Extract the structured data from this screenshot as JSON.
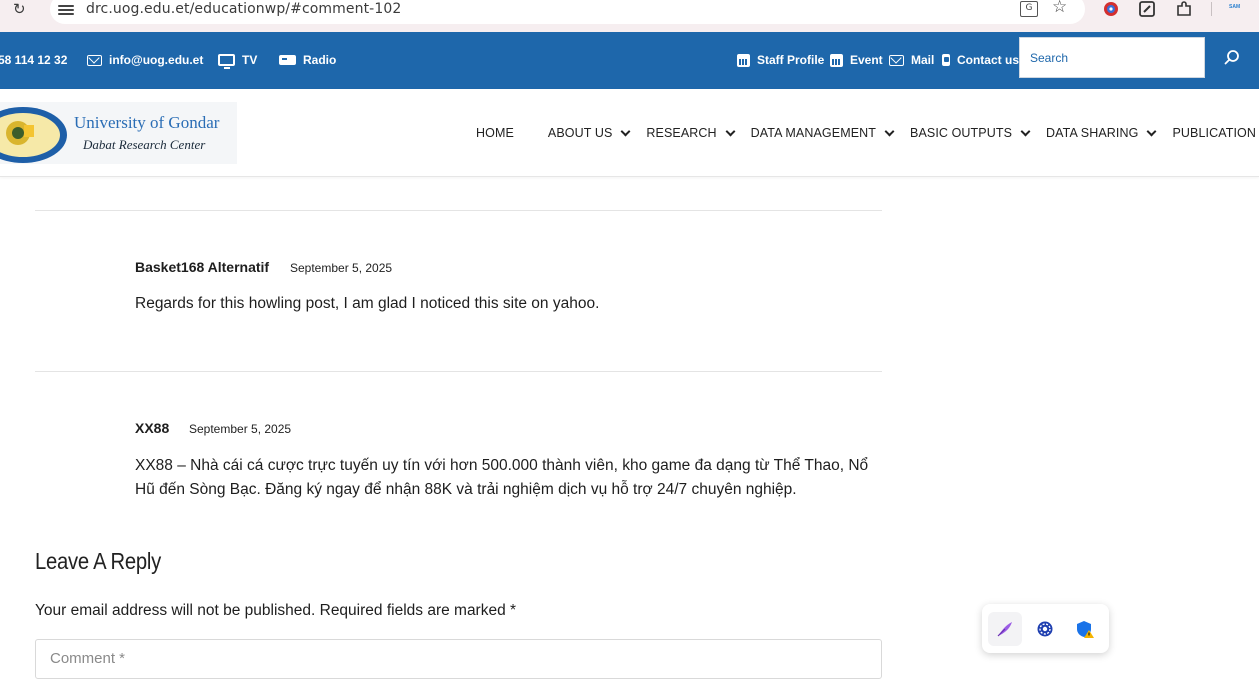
{
  "browser": {
    "url": "drc.uog.edu.et/educationwp/#comment-102"
  },
  "topbar": {
    "phone": "58 114 12 32",
    "email": "info@uog.edu.et",
    "tv": "TV",
    "radio": "Radio",
    "staff_profile": "Staff Profile",
    "event": "Event",
    "mail": "Mail",
    "contact": "Contact us",
    "search_placeholder": "Search"
  },
  "logo": {
    "line1": "University of Gondar",
    "line2": "Dabat Research Center"
  },
  "nav": {
    "items": [
      {
        "label": "HOME",
        "dropdown": false
      },
      {
        "label": "ABOUT US",
        "dropdown": true
      },
      {
        "label": "RESEARCH",
        "dropdown": true
      },
      {
        "label": "DATA MANAGEMENT",
        "dropdown": true
      },
      {
        "label": "BASIC OUTPUTS",
        "dropdown": true
      },
      {
        "label": "DATA SHARING",
        "dropdown": true
      },
      {
        "label": "PUBLICATION",
        "dropdown": true
      }
    ]
  },
  "comments": [
    {
      "author": "Basket168 Alternatif",
      "date": "September 5, 2025",
      "text": "Regards for this howling post, I am glad I noticed this site on yahoo."
    },
    {
      "author": "XX88",
      "date": "September 5, 2025",
      "text": "XX88 – Nhà cái cá cược trực tuyến uy tín với hơn 500.000 thành viên, kho game đa dạng từ Thể Thao, Nổ Hũ đến Sòng Bạc. Đăng ký ngay để nhận 88K và trải nghiệm dịch vụ hỗ trợ 24/7 chuyên nghiệp."
    }
  ],
  "reply": {
    "title": "Leave A Reply",
    "note": "Your email address will not be published. Required fields are marked *",
    "comment_placeholder": "Comment *"
  },
  "colors": {
    "brand_blue": "#1e67ab",
    "chrome_bg": "#f6eef0"
  },
  "icons": {
    "float_toolbar": [
      "quill-icon",
      "settings-badge-icon",
      "shield-warning-icon"
    ]
  }
}
